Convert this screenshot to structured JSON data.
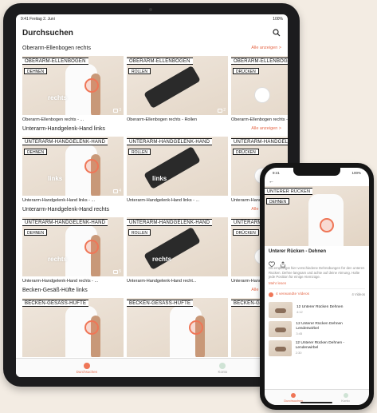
{
  "ipad": {
    "status_left": "9:41  Freitag 2. Juni",
    "status_right": "100%",
    "title": "Durchsuchen",
    "sections": [
      {
        "title": "Oberarm-Ellenbogen rechts",
        "show_all": "Alle anzeigen >",
        "cards": [
          {
            "title": "OBERARM-ELLENBOGEN",
            "tag": "DEHNEN",
            "side": "rechts",
            "badge": "3",
            "caption": "Oberarm-Ellenbogen rechts - ..."
          },
          {
            "title": "OBERARM-ELLENBOGEN",
            "tag": "ROLLEN",
            "side": "",
            "badge": "2",
            "caption": "Oberarm-Ellenbogen rechts - Rollen"
          },
          {
            "title": "OBERARM-ELLENBOGEN",
            "tag": "DRÜCKEN",
            "side": "",
            "badge": "",
            "caption": "Oberarm-Ellenbogen rechts - ..."
          }
        ]
      },
      {
        "title": "Unterarm-Handgelenk-Hand links",
        "show_all": "Alle anzeigen >",
        "cards": [
          {
            "title": "UNTERARM-HANDGELENK-HAND",
            "tag": "DEHNEN",
            "side": "links",
            "badge": "4",
            "caption": "Unterarm-Handgelenk-Hand links - ..."
          },
          {
            "title": "UNTERARM-HANDGELENK-HAND",
            "tag": "ROLLEN",
            "side": "links",
            "badge": "",
            "caption": "Unterarm-Handgelenk-Hand links - ..."
          },
          {
            "title": "UNTERARM-HANDGELENK-HAND",
            "tag": "DRÜCKEN",
            "side": "",
            "badge": "",
            "caption": "Unterarm-Handgelenk-Hand links - ..."
          }
        ]
      },
      {
        "title": "Unterarm-Handgelenk-Hand rechts",
        "show_all": "Alle anzeigen >",
        "cards": [
          {
            "title": "UNTERARM-HANDGELENK-HAND",
            "tag": "DEHNEN",
            "side": "rechts",
            "badge": "5",
            "caption": "Unterarm-Handgelenk-Hand rechts - ..."
          },
          {
            "title": "UNTERARM-HANDGELENK-HAND",
            "tag": "ROLLEN",
            "side": "rechts",
            "badge": "",
            "caption": "Unterarm-Handgelenk-Hand recht..."
          },
          {
            "title": "UNTERARM-HANDGELENK-HAND",
            "tag": "DRÜCKEN",
            "side": "",
            "badge": "",
            "caption": "Unterarm-Handgelenk-Hand recht..."
          }
        ]
      },
      {
        "title": "Becken-Gesäß-Hüfte links",
        "show_all": "Alle anzeigen >",
        "cards": [
          {
            "title": "BECKEN-GESÄSS-HÜFTE",
            "tag": "",
            "side": "",
            "badge": "",
            "caption": ""
          },
          {
            "title": "BECKEN-GESÄSS-HÜFTE",
            "tag": "",
            "side": "",
            "badge": "",
            "caption": ""
          },
          {
            "title": "BECKEN-GESÄSS-HÜFTE",
            "tag": "",
            "side": "",
            "badge": "",
            "caption": ""
          }
        ]
      }
    ],
    "tabs": [
      {
        "label": "Durchsuchen",
        "active": true
      },
      {
        "label": "Konto",
        "active": false
      }
    ]
  },
  "iphone": {
    "status_left": "9:41",
    "status_right": "100%",
    "back": "←",
    "hero_title": "UNTERER RÜCKEN",
    "hero_tag": "DEHNEN",
    "title": "Unterer Rücken - Dehnen",
    "description": "Du empfängst hier verschiedene Dehnübungen für den unteren Rücken. Dehne langsam und achte auf deine Atmung. Halte jede Position für einige Atemzüge.",
    "more": "Mehr lesen",
    "section_label": "4 verwandte Videos",
    "section_count": "4 Videos",
    "items": [
      {
        "title": "12 Unterer Rücken Dehnen",
        "sub": "4:12"
      },
      {
        "title": "12 Unterer Rücken Dehnen Lendenwirbel",
        "sub": "3:45"
      },
      {
        "title": "12 Unterer Rücken Dehnen - Lendenwirbel",
        "sub": "2:30"
      }
    ],
    "tabs": [
      {
        "label": "Durchsuchen",
        "active": true
      },
      {
        "label": "Konto",
        "active": false
      }
    ]
  },
  "colors": {
    "accent": "#e6694a",
    "background": "#f3ece3"
  }
}
